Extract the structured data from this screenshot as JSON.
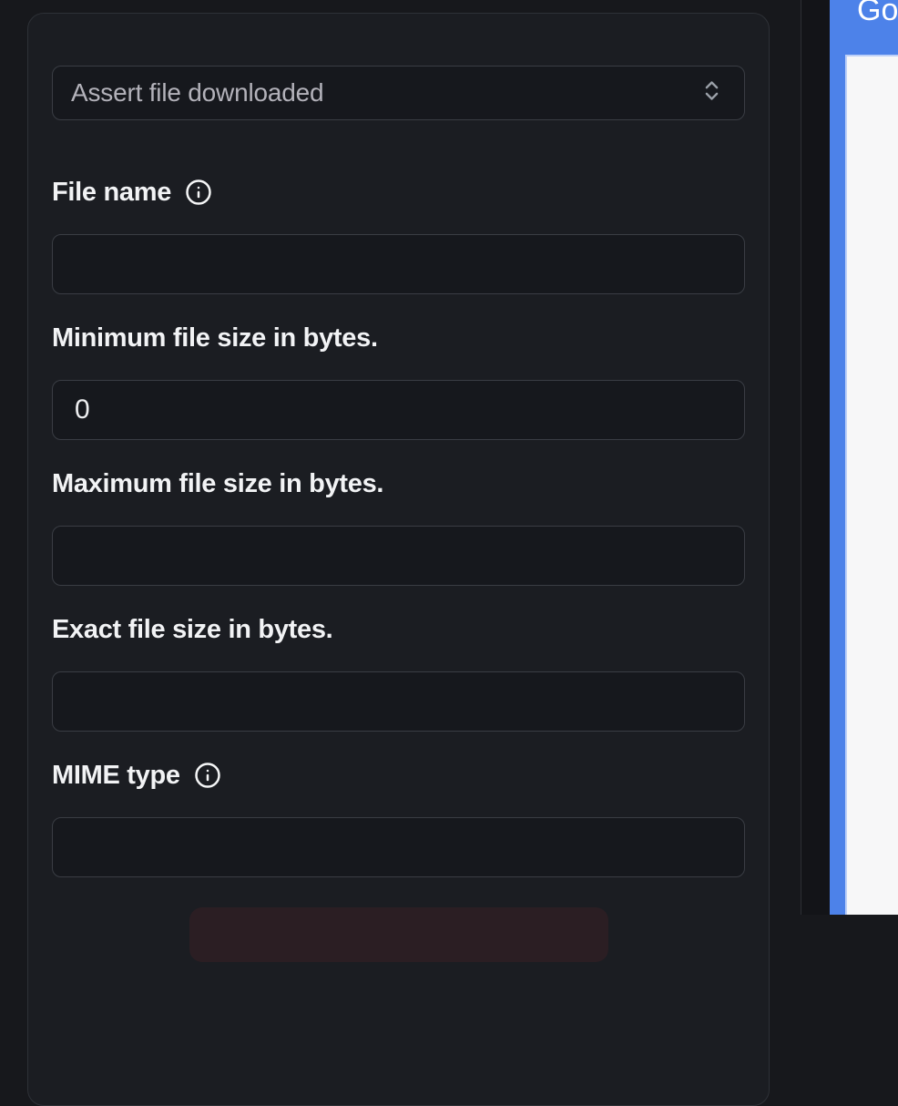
{
  "action_select": {
    "value": "Assert file downloaded"
  },
  "fields": [
    {
      "label": "File name",
      "value": ""
    },
    {
      "label": "Minimum file size in bytes.",
      "value": "0"
    },
    {
      "label": "Maximum file size in bytes.",
      "value": ""
    },
    {
      "label": "Exact file size in bytes.",
      "value": ""
    },
    {
      "label": "MIME type",
      "value": ""
    }
  ],
  "preview": {
    "heading_visible_text": "Go"
  },
  "colors": {
    "accent_blue": "#4d82e9",
    "page_white": "#f7f7f8",
    "panel_bg": "#1b1d22",
    "input_bg": "#16181d",
    "danger_bg": "#2b1e23"
  }
}
